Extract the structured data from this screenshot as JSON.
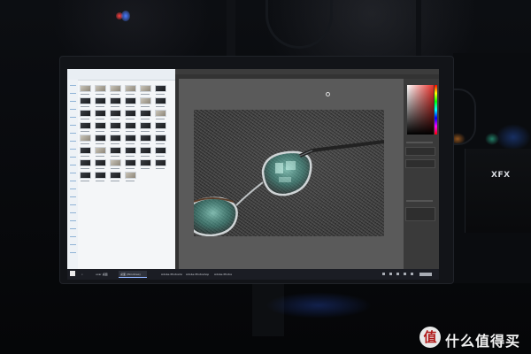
{
  "scene": {
    "description_type": "photo of a monitor on a desk in a dark room",
    "pc_brand": "XFX"
  },
  "monitor": {
    "left_app": "file-explorer",
    "right_app": "photoshop",
    "explorer_thumbnail_count": 46
  },
  "taskbar": {
    "items": [
      "ucar 桌面",
      "桌面 (Windows)",
      "Adobe Photoshop",
      "Adobe Photoshop CC",
      "Adobe Photoshop CC"
    ]
  },
  "watermark": {
    "logo_char": "值",
    "text": "什么值得买"
  },
  "colors": {
    "accent_red": "#e8302a",
    "taskbar": "#1b1d24"
  }
}
